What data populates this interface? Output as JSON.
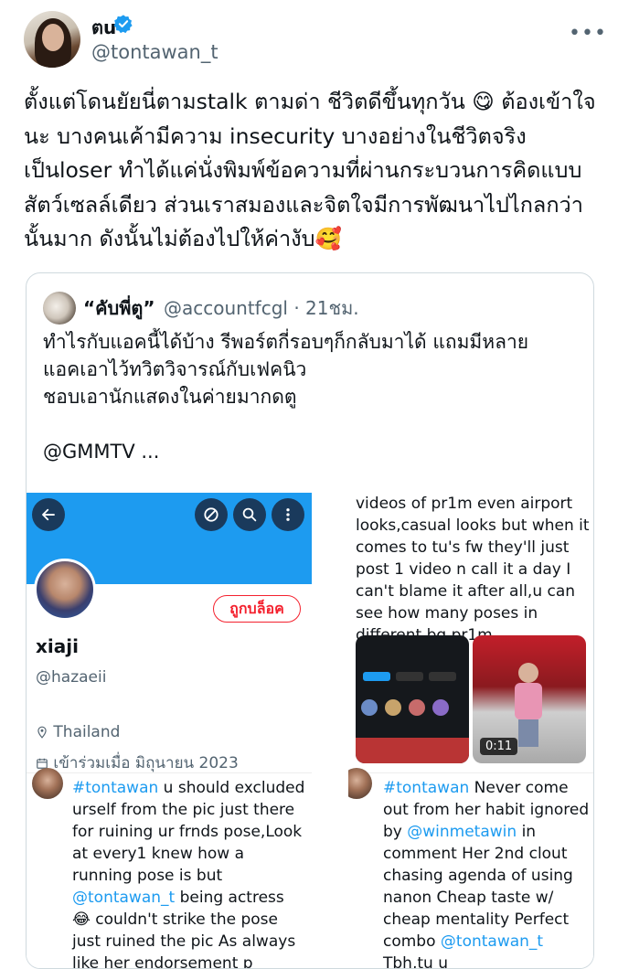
{
  "author": {
    "name": "ตu",
    "handle": "@tontawan_t"
  },
  "tweet": {
    "text": "ตั้งแต่โดนยัยนี่ตามstalk ตามด่า ชีวิตดีขึ้นทุกวัน 😋 ต้องเข้าใจนะ บางคนเค้ามีความ insecurity บางอย่างในชีวิตจริง เป็นloser ทำได้แค่นั่งพิมพ์ข้อความที่ผ่านกระบวนการคิดแบบสัตว์เซลล์เดียว ส่วนเราสมองและจิตใจมีการพัฒนาไปไกลกว่านั้นมาก ดังนั้นไม่ต้องไปให้ค่างับ🥰"
  },
  "quote": {
    "name": "“คับพี่ตู”",
    "handle": "@accountfcgl · 21ชม.",
    "lines": [
      "ทำไรกับแอคนี้ได้บ้าง รีพอร์ตกี่รอบๆก็กลับมาได้ แถมมีหลาย",
      "แอคเอาไว้ทวิตวิจารณ์กับเฟคนิว",
      "ชอบเอานักแสดงในค่ายมากดตู",
      "",
      "@GMMTV ..."
    ],
    "left_shot": {
      "blocked_label": "ถูกบล็อค",
      "profile_name": "xiaji",
      "profile_handle": "@hazaeii",
      "location": "Thailand",
      "joined": "เข้าร่วมเมื่อ มิถุนายน 2023",
      "reply_tag": "#tontawan",
      "reply_text": " u should excluded urself from the pic just there for ruining ur frnds pose,Look at every1 knew how a running pose is but ",
      "reply_mention": "@tontawan_t",
      "reply_text2": " being actress 😂 couldn't strike the pose just ruined the pic As always like her endorsement p"
    },
    "right_shot": {
      "top_text": "videos of pr1m even airport looks,casual looks but when it comes to tu's fw they'll just post 1 video n call it a day I can't blame it after all,u can see how many poses in different bg pr1m",
      "video_duration": "0:11",
      "reply_tag": "#tontawan",
      "reply_text": " Never come out from her habit ignored by ",
      "reply_mention": "@winmetawin",
      "reply_text2": " in comment Her 2nd clout chasing agenda of using nanon Cheap taste w/ cheap mentality Perfect combo ",
      "reply_mention2": "@tontawan_t",
      "reply_text3": " Tbh,tu u"
    }
  },
  "icons": {
    "verified": "verified-badge-icon",
    "more": "more-icon",
    "back": "back-arrow-icon",
    "block": "block-icon",
    "search": "search-icon",
    "kebab": "kebab-icon",
    "location": "location-pin-icon",
    "calendar": "calendar-icon"
  },
  "colors": {
    "brand_blue": "#1d9bf0",
    "text": "#0f1419",
    "muted": "#536471",
    "danger": "#f4212e"
  }
}
